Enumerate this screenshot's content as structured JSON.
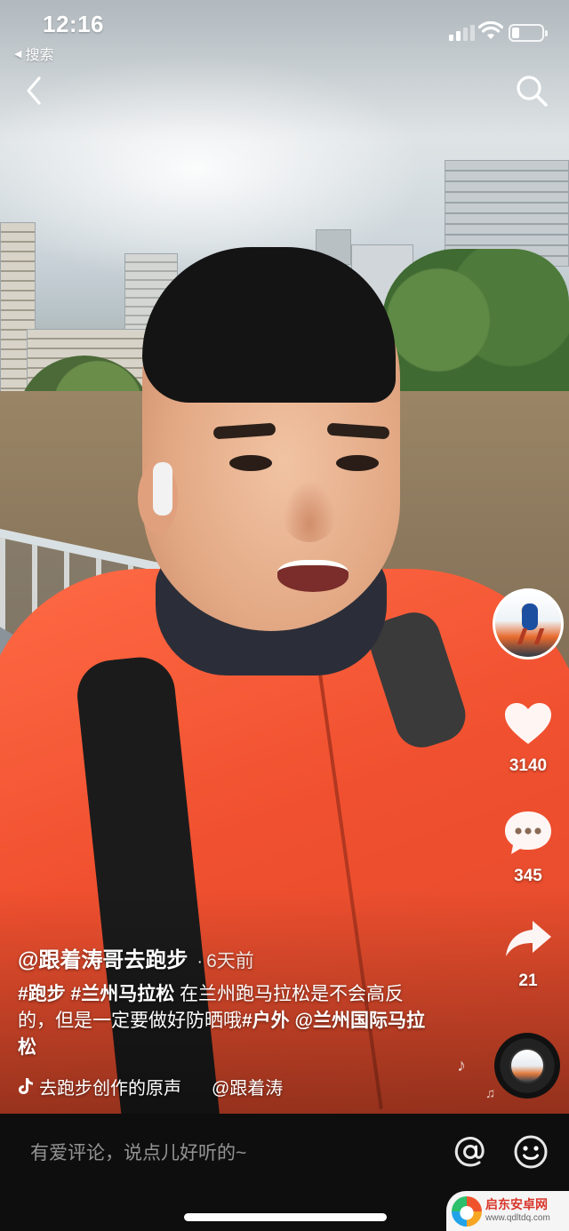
{
  "status_bar": {
    "time": "12:16",
    "back_app": "搜索",
    "battery_level": 0.25
  },
  "video": {
    "author": "@跟着涛哥去跑步",
    "separator": "·",
    "posted_ago": "6天前",
    "caption": {
      "tag1": "#跑步",
      "tag2": "#兰州马拉松",
      "text1": "在兰州跑马拉松是不会高反的，但是一定要做好防晒哦",
      "tag3": "#户外",
      "mention": "@兰州国际马拉松"
    },
    "music": {
      "title": "去跑步创作的原声",
      "credit": "@跟着涛"
    }
  },
  "actions": {
    "likes": "3140",
    "comments": "345",
    "shares": "21"
  },
  "comment_bar": {
    "placeholder": "有爱评论，说点儿好听的~"
  },
  "watermark": {
    "name": "启东安卓网",
    "url": "www.qdltdq.com"
  },
  "icons": {
    "back": "chevron-left-icon",
    "search": "search-icon",
    "like": "heart-icon",
    "comment": "comment-bubble-icon",
    "share": "share-arrow-icon",
    "at": "at-sign-icon",
    "emoji": "smiley-icon",
    "music": "tiktok-note-icon"
  },
  "colors": {
    "accent": "#fe2c55",
    "watermark_red": "#d9362b"
  }
}
